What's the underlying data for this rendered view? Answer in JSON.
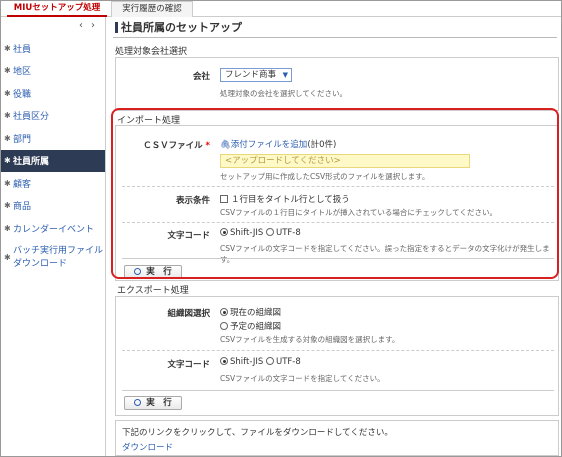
{
  "tabs": [
    {
      "label": "MIUセットアップ処理"
    },
    {
      "label": "実行履歴の確認"
    }
  ],
  "sidebar": {
    "items": [
      {
        "label": "社員"
      },
      {
        "label": "地区"
      },
      {
        "label": "役職"
      },
      {
        "label": "社員区分"
      },
      {
        "label": "部門"
      },
      {
        "label": "社員所属"
      },
      {
        "label": "顧客"
      },
      {
        "label": "商品"
      },
      {
        "label": "カレンダーイベント"
      },
      {
        "label_line1": "バッチ実行用ファイル",
        "label_line2": "ダウンロード"
      }
    ]
  },
  "page": {
    "title": "社員所属のセットアップ"
  },
  "company_section": {
    "heading": "処理対象会社選択",
    "company_label": "会社",
    "company_value": "フレンド商事",
    "company_note": "処理対象の会社を選択してください。"
  },
  "import_section": {
    "heading": "インポート処理",
    "csv_label": "ＣＳＶファイル",
    "required_mark": "*",
    "attach_link": "添付ファイルを追加",
    "attach_count": "(計0件)",
    "upload_placeholder": "<アップロードしてください>",
    "csv_note": "セットアップ用に作成したCSV形式のファイルを選択します。",
    "display_label": "表示条件",
    "title_row_check": "１行目をタイトル行として扱う",
    "title_row_note": "CSVファイルの１行目にタイトルが挿入されている場合にチェックしてください。",
    "charcode_label": "文字コード",
    "charcode_opt1": "Shift-JIS",
    "charcode_opt2": "UTF-8",
    "charcode_note": "CSVファイルの文字コードを指定してください。誤った指定をするとデータの文字化けが発生します。",
    "run_label": "実　行"
  },
  "export_section": {
    "heading": "エクスポート処理",
    "org_label": "組織図選択",
    "org_opt1": "現在の組織図",
    "org_opt2": "予定の組織図",
    "org_note": "CSVファイルを生成する対象の組織図を選択します。",
    "charcode_label": "文字コード",
    "charcode_opt1": "Shift-JIS",
    "charcode_opt2": "UTF-8",
    "charcode_note": "CSVファイルの文字コードを指定してください。",
    "run_label": "実　行"
  },
  "download_section": {
    "text": "下記のリンクをクリックして、ファイルをダウンロードしてください。",
    "link": "ダウンロード"
  }
}
